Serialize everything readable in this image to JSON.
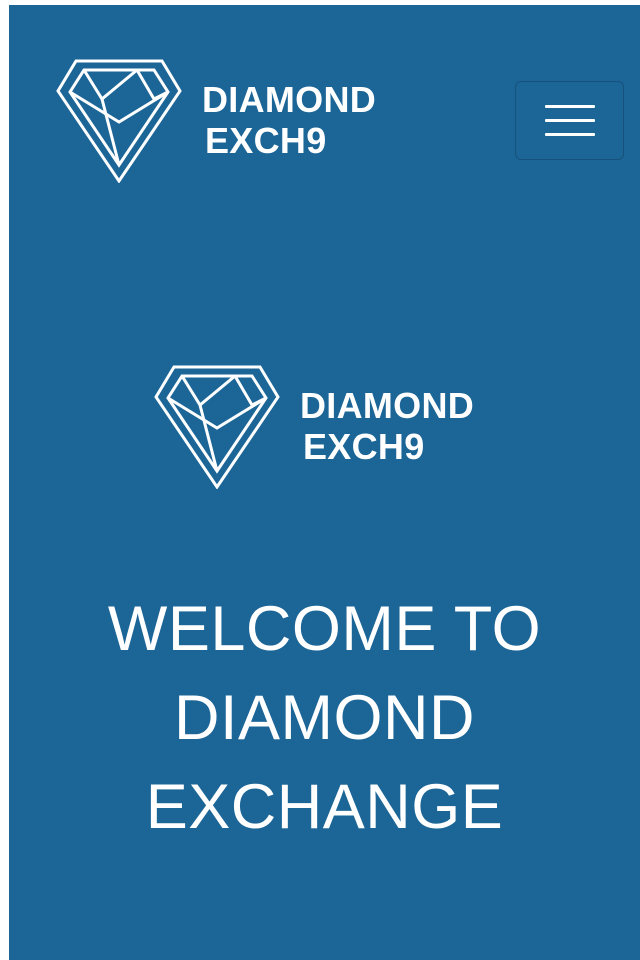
{
  "header": {
    "logo": {
      "line1": "DIAMOND",
      "line2": "EXCH9"
    },
    "menu_icon": "hamburger-menu-icon"
  },
  "hero": {
    "logo": {
      "line1": "DIAMOND",
      "line2": "EXCH9"
    },
    "welcome_lines": [
      "WELCOME TO",
      "DIAMOND",
      "EXCHANGE"
    ]
  },
  "colors": {
    "background": "#1b6597",
    "text": "#ffffff"
  }
}
